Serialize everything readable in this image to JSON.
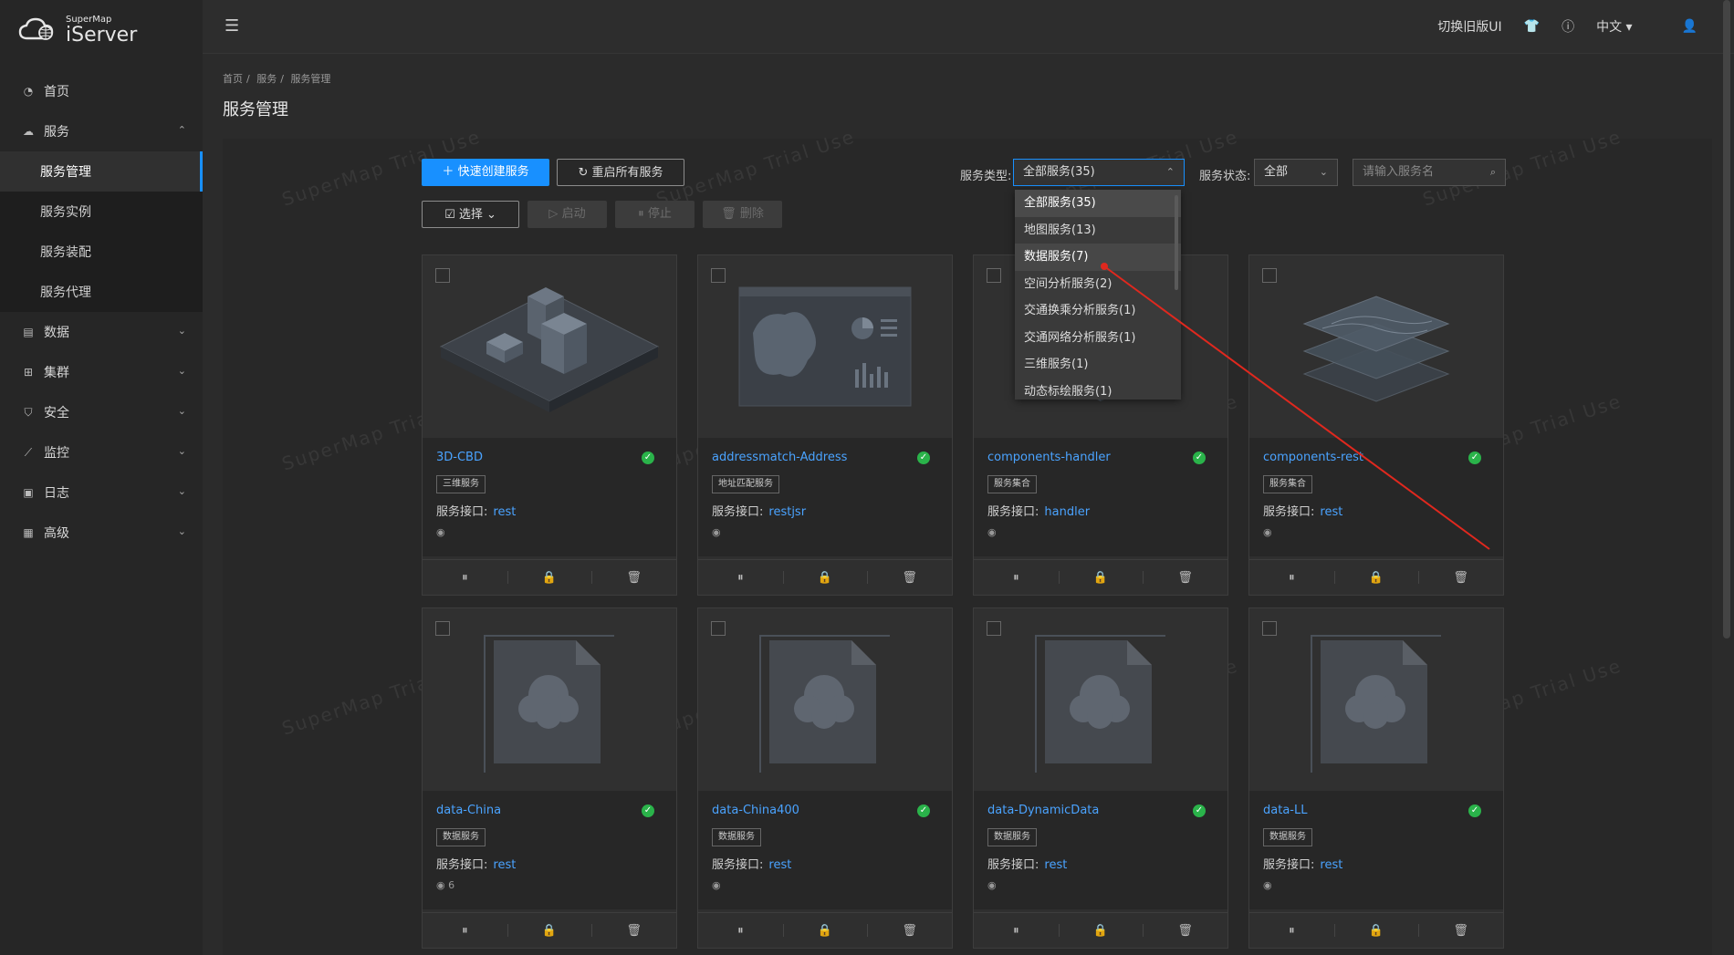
{
  "app": {
    "logo_small": "SuperMap",
    "logo_big": "iServer"
  },
  "topbar": {
    "switch_ui": "切换旧版UI",
    "language": "中文"
  },
  "sidebar": {
    "items": [
      {
        "label": "首页",
        "icon": "dashboard-icon"
      },
      {
        "label": "服务",
        "icon": "cloud-icon",
        "expanded": true
      },
      {
        "label": "数据",
        "icon": "database-icon"
      },
      {
        "label": "集群",
        "icon": "cluster-icon"
      },
      {
        "label": "安全",
        "icon": "shield-icon"
      },
      {
        "label": "监控",
        "icon": "chart-icon"
      },
      {
        "label": "日志",
        "icon": "log-icon"
      },
      {
        "label": "高级",
        "icon": "advanced-icon"
      }
    ],
    "sub_items": [
      "服务管理",
      "服务实例",
      "服务装配",
      "服务代理"
    ]
  },
  "breadcrumb": [
    "首页",
    "服务",
    "服务管理"
  ],
  "page_title": "服务管理",
  "toolbar": {
    "quick_create": "快速创建服务",
    "restart_all": "重启所有服务",
    "select": "选择",
    "start": "启动",
    "stop": "停止",
    "delete": "删除"
  },
  "filters": {
    "type_label": "服务类型:",
    "type_value": "全部服务(35)",
    "status_label": "服务状态:",
    "status_value": "全部",
    "search_placeholder": "请输入服务名"
  },
  "dropdown": {
    "options": [
      "全部服务(35)",
      "地图服务(13)",
      "数据服务(7)",
      "空间分析服务(2)",
      "交通换乘分析服务(1)",
      "交通网络分析服务(1)",
      "三维服务(1)",
      "动态标绘服务(1)"
    ],
    "selected": "全部服务(35)",
    "hovered": "数据服务(7)"
  },
  "watermark": "SuperMap Trial Use",
  "interface_label": "服务接口:",
  "cards": [
    {
      "name": "3D-CBD",
      "tag": "三维服务",
      "iface": "rest",
      "views": "",
      "image": "3d-city"
    },
    {
      "name": "addressmatch-Address",
      "tag": "地址匹配服务",
      "iface": "restjsr",
      "views": "",
      "image": "map-dashboard"
    },
    {
      "name": "components-handler",
      "tag": "服务集合",
      "iface": "handler",
      "views": "",
      "image": "components"
    },
    {
      "name": "components-rest",
      "tag": "服务集合",
      "iface": "rest",
      "views": "",
      "image": "layers"
    },
    {
      "name": "data-China",
      "tag": "数据服务",
      "iface": "rest",
      "views": "6",
      "image": "cloud-doc"
    },
    {
      "name": "data-China400",
      "tag": "数据服务",
      "iface": "rest",
      "views": "",
      "image": "cloud-doc"
    },
    {
      "name": "data-DynamicData",
      "tag": "数据服务",
      "iface": "rest",
      "views": "",
      "image": "cloud-doc"
    },
    {
      "name": "data-LL",
      "tag": "数据服务",
      "iface": "rest",
      "views": "",
      "image": "cloud-doc"
    }
  ],
  "colors": {
    "accent": "#1890ff",
    "status_ok": "#2ab34a",
    "link": "#4aa3ff",
    "annotation": "#e0281e"
  }
}
